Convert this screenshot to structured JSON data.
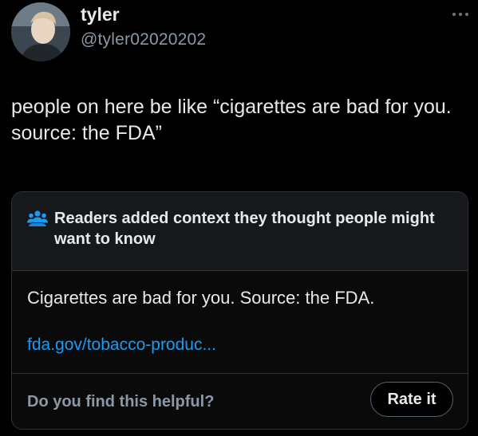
{
  "tweet": {
    "display_name": "tyler",
    "handle": "@tyler02020202",
    "text": "people on here be like “cigarettes are bad for you. source: the FDA”"
  },
  "community_note": {
    "title": "Readers added context they thought people might want to know",
    "body": "Cigarettes are bad for you. Source: the FDA.",
    "link_text": "fda.gov/tobacco-produc...",
    "helpful_question": "Do you find this helpful?",
    "rate_button_label": "Rate it"
  },
  "icons": {
    "more": "more-horizontal-icon",
    "note": "people-group-icon"
  },
  "colors": {
    "background": "#000000",
    "text_primary": "#e7e9ea",
    "text_secondary": "#8b98a5",
    "link": "#1d9bf0",
    "border": "#2f3336",
    "note_header_bg": "#16181c"
  }
}
